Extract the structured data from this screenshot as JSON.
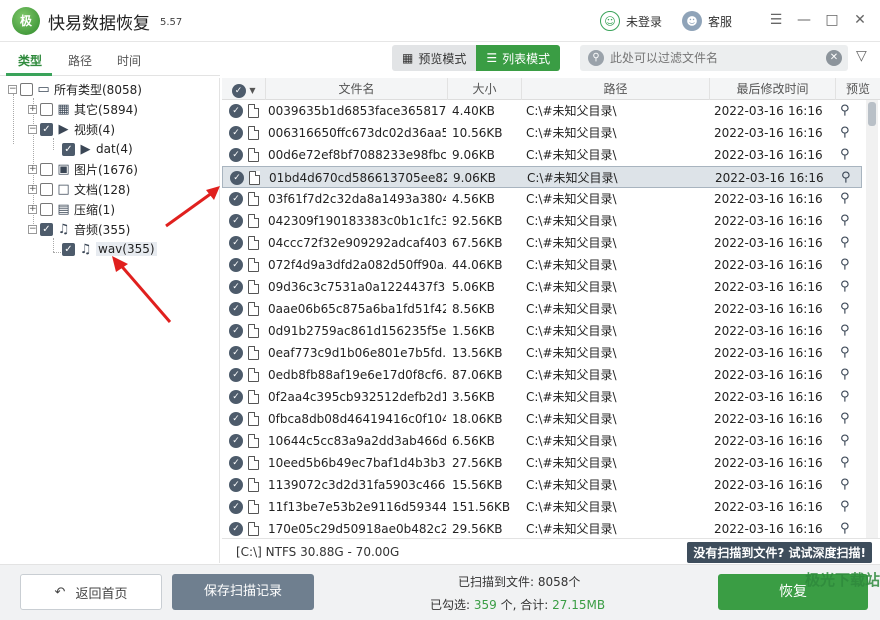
{
  "app": {
    "logo_text": "极",
    "title": "快易数据恢复",
    "version": "5.57",
    "user_label": "未登录",
    "service_label": "客服"
  },
  "left_tabs": [
    {
      "label": "类型",
      "active": true
    },
    {
      "label": "路径",
      "active": false
    },
    {
      "label": "时间",
      "active": false
    }
  ],
  "tree": {
    "root": "所有类型(8058)",
    "other": "其它(5894)",
    "video": "视频(4)",
    "video_dat": "dat(4)",
    "image": "图片(1676)",
    "doc": "文档(128)",
    "archive": "压缩(1)",
    "audio": "音频(355)",
    "audio_wav": "wav(355)"
  },
  "toolbar": {
    "preview_mode": "预览模式",
    "list_mode": "列表模式",
    "search_placeholder": "此处可以过滤文件名"
  },
  "table": {
    "headers": {
      "name": "文件名",
      "size": "大小",
      "path": "路径",
      "modified": "最后修改时间",
      "preview": "预览"
    },
    "rows": [
      {
        "name": "0039635b1d6853face365817...",
        "size": "4.40KB",
        "path": "C:\\#未知父目录\\",
        "date": "2022-03-16",
        "time": "16:16"
      },
      {
        "name": "006316650ffc673dc02d36aa5...",
        "size": "10.56KB",
        "path": "C:\\#未知父目录\\",
        "date": "2022-03-16",
        "time": "16:16"
      },
      {
        "name": "00d6e72ef8bf7088233e98fbc...",
        "size": "9.06KB",
        "path": "C:\\#未知父目录\\",
        "date": "2022-03-16",
        "time": "16:16"
      },
      {
        "name": "01bd4d670cd586613705ee82...",
        "size": "9.06KB",
        "path": "C:\\#未知父目录\\",
        "date": "2022-03-16",
        "time": "16:16",
        "selected": true
      },
      {
        "name": "03f61f7d2c32da8a1493a3804...",
        "size": "4.56KB",
        "path": "C:\\#未知父目录\\",
        "date": "2022-03-16",
        "time": "16:16"
      },
      {
        "name": "042309f190183383c0b1c1fc3...",
        "size": "92.56KB",
        "path": "C:\\#未知父目录\\",
        "date": "2022-03-16",
        "time": "16:16"
      },
      {
        "name": "04ccc72f32e909292adcaf403...",
        "size": "67.56KB",
        "path": "C:\\#未知父目录\\",
        "date": "2022-03-16",
        "time": "16:16"
      },
      {
        "name": "072f4d9a3dfd2a082d50ff90a...",
        "size": "44.06KB",
        "path": "C:\\#未知父目录\\",
        "date": "2022-03-16",
        "time": "16:16"
      },
      {
        "name": "09d36c3c7531a0a1224437f39...",
        "size": "5.06KB",
        "path": "C:\\#未知父目录\\",
        "date": "2022-03-16",
        "time": "16:16"
      },
      {
        "name": "0aae06b65c875a6ba1fd51f42...",
        "size": "8.56KB",
        "path": "C:\\#未知父目录\\",
        "date": "2022-03-16",
        "time": "16:16"
      },
      {
        "name": "0d91b2759ac861d156235f5e...",
        "size": "1.56KB",
        "path": "C:\\#未知父目录\\",
        "date": "2022-03-16",
        "time": "16:16"
      },
      {
        "name": "0eaf773c9d1b06e801e7b5fd...",
        "size": "13.56KB",
        "path": "C:\\#未知父目录\\",
        "date": "2022-03-16",
        "time": "16:16"
      },
      {
        "name": "0edb8fb88af19e6e17d0f8cf6...",
        "size": "87.06KB",
        "path": "C:\\#未知父目录\\",
        "date": "2022-03-16",
        "time": "16:16"
      },
      {
        "name": "0f2aa4c395cb932512defb2d1...",
        "size": "3.56KB",
        "path": "C:\\#未知父目录\\",
        "date": "2022-03-16",
        "time": "16:16"
      },
      {
        "name": "0fbca8db08d46419416c0f104...",
        "size": "18.06KB",
        "path": "C:\\#未知父目录\\",
        "date": "2022-03-16",
        "time": "16:16"
      },
      {
        "name": "10644c5cc83a9a2dd3ab466d...",
        "size": "6.56KB",
        "path": "C:\\#未知父目录\\",
        "date": "2022-03-16",
        "time": "16:16"
      },
      {
        "name": "10eed5b6b49ec7baf1d4b3b3...",
        "size": "27.56KB",
        "path": "C:\\#未知父目录\\",
        "date": "2022-03-16",
        "time": "16:16"
      },
      {
        "name": "1139072c3d2d31fa5903c466...",
        "size": "15.56KB",
        "path": "C:\\#未知父目录\\",
        "date": "2022-03-16",
        "time": "16:16"
      },
      {
        "name": "11f13be7e53b2e9116d59344...",
        "size": "151.56KB",
        "path": "C:\\#未知父目录\\",
        "date": "2022-03-16",
        "time": "16:16"
      },
      {
        "name": "170e05c29d50918ae0b482c2...",
        "size": "29.56KB",
        "path": "C:\\#未知父目录\\",
        "date": "2022-03-16",
        "time": "16:16"
      }
    ]
  },
  "status": {
    "disk_info": "[C:\\] NTFS 30.88G - 70.00G",
    "deep_scan": "没有扫描到文件? 试试深度扫描!"
  },
  "bottom": {
    "home_button": "返回首页",
    "save_button": "保存扫描记录",
    "scan_count_label": "已扫描到文件: 8058个",
    "selected_label": "已勾选:",
    "selected_count": "359",
    "selected_unit": "个, 合计:",
    "selected_total": "27.15MB",
    "recover_button": "恢复",
    "watermark": "极光下载站"
  },
  "colors": {
    "accent": "#3a9d44",
    "checkbox": "#4d5b6b",
    "arrow": "#e0201e"
  }
}
